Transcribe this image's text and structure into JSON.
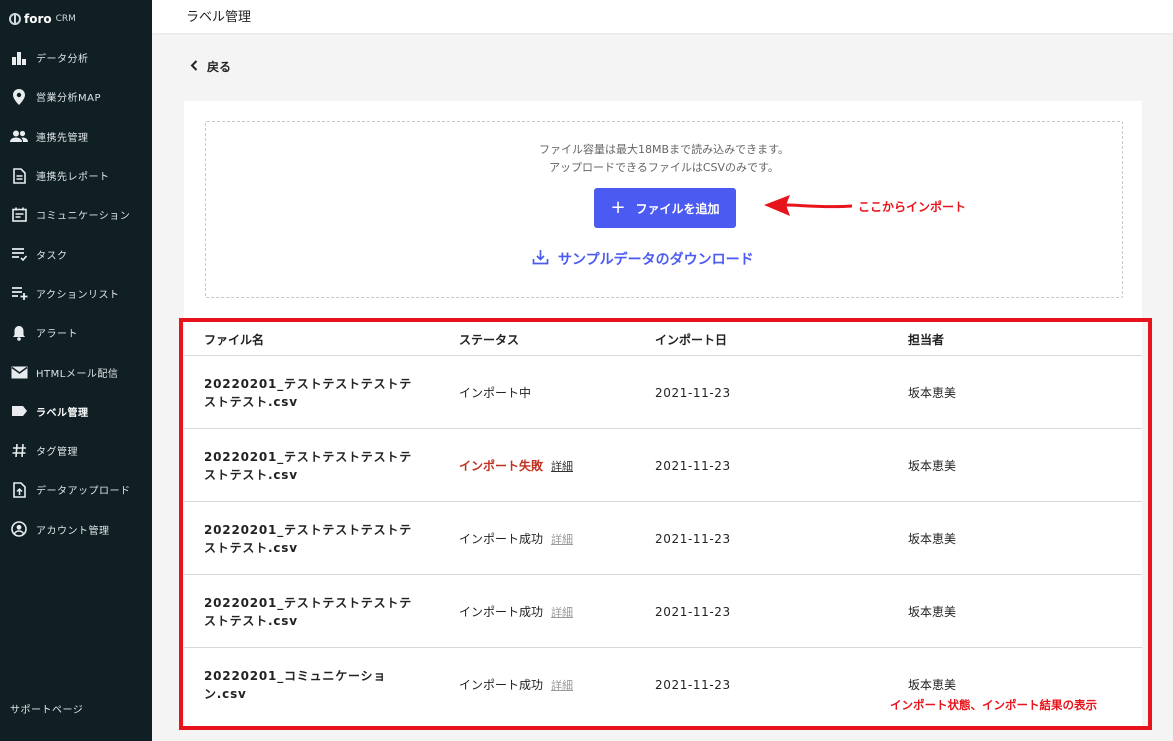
{
  "app": {
    "brand": "foro",
    "brand_suffix": "CRM"
  },
  "sidebar": {
    "items": [
      {
        "label": "データ分析",
        "icon": "bar-chart-icon"
      },
      {
        "label": "営業分析MAP",
        "icon": "map-pin-icon"
      },
      {
        "label": "連携先管理",
        "icon": "people-icon"
      },
      {
        "label": "連携先レポート",
        "icon": "document-icon"
      },
      {
        "label": "コミュニケーション",
        "icon": "calendar-icon"
      },
      {
        "label": "タスク",
        "icon": "task-list-icon"
      },
      {
        "label": "アクションリスト",
        "icon": "playlist-add-icon"
      },
      {
        "label": "アラート",
        "icon": "bell-icon"
      },
      {
        "label": "HTMLメール配信",
        "icon": "mail-icon"
      },
      {
        "label": "ラベル管理",
        "icon": "label-icon",
        "active": true
      },
      {
        "label": "タグ管理",
        "icon": "hashtag-icon"
      },
      {
        "label": "データアップロード",
        "icon": "upload-icon"
      },
      {
        "label": "アカウント管理",
        "icon": "account-icon"
      }
    ],
    "support": "サポートページ"
  },
  "header": {
    "title": "ラベル管理"
  },
  "back": {
    "label": "戻る"
  },
  "upload": {
    "line1": "ファイル容量は最大18MBまで読み込みできます。",
    "line2": "アップロードできるファイルはCSVのみです。",
    "add_button": "ファイルを追加",
    "sample_link": "サンプルデータのダウンロード"
  },
  "table": {
    "headers": {
      "file": "ファイル名",
      "status": "ステータス",
      "date": "インポート日",
      "owner": "担当者"
    },
    "rows": [
      {
        "file_line1": "20220201_テストテストテストテ",
        "file_line2": "ストテスト.csv",
        "status": "インポート中",
        "detail": "",
        "date": "2021-11-23",
        "owner": "坂本恵美"
      },
      {
        "file_line1": "20220201_テストテストテストテ",
        "file_line2": "ストテスト.csv",
        "status": "インポート失敗",
        "detail": "詳細",
        "date": "2021-11-23",
        "owner": "坂本恵美"
      },
      {
        "file_line1": "20220201_テストテストテストテ",
        "file_line2": "ストテスト.csv",
        "status": "インポート成功",
        "detail": "詳細",
        "date": "2021-11-23",
        "owner": "坂本恵美"
      },
      {
        "file_line1": "20220201_テストテストテストテ",
        "file_line2": "ストテスト.csv",
        "status": "インポート成功",
        "detail": "詳細",
        "date": "2021-11-23",
        "owner": "坂本恵美"
      },
      {
        "file_line1": "20220201_コミュニケーショ",
        "file_line2": "ン.csv",
        "status": "インポート成功",
        "detail": "詳細",
        "date": "2021-11-23",
        "owner": "坂本恵美"
      }
    ]
  },
  "annotations": {
    "import_note": "ここからインポート",
    "result_note": "インポート状態、インポート結果の表示",
    "color": "#e8141b"
  },
  "colors": {
    "accent": "#4b5bf2",
    "sidebar": "#0f1f24",
    "fail": "#c0311d"
  }
}
